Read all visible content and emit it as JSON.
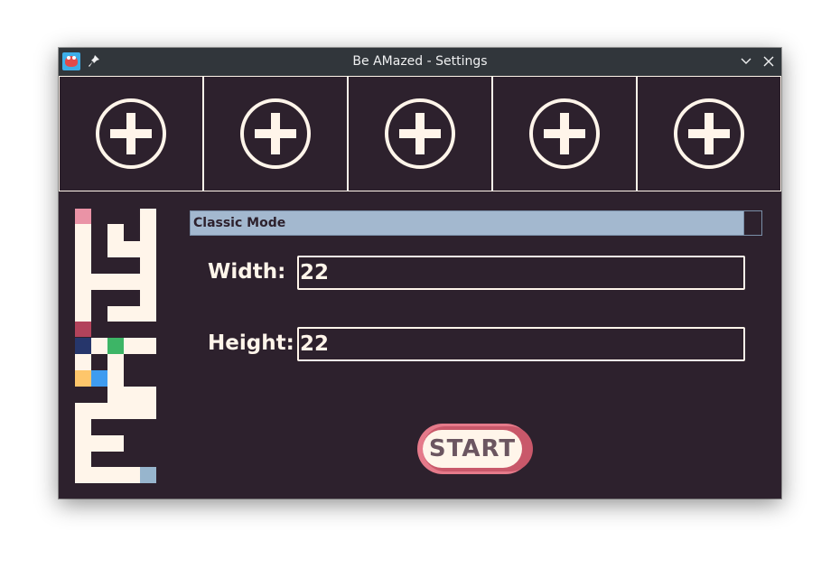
{
  "window": {
    "title": "Be AMazed - Settings"
  },
  "player_slots": [
    {
      "icon": "add-circle-icon"
    },
    {
      "icon": "add-circle-icon"
    },
    {
      "icon": "add-circle-icon"
    },
    {
      "icon": "add-circle-icon"
    },
    {
      "icon": "add-circle-icon"
    }
  ],
  "settings": {
    "mode": {
      "selected": "Classic Mode"
    },
    "width": {
      "label": "Width:",
      "value": "22"
    },
    "height": {
      "label": "Height:",
      "value": "22"
    }
  },
  "start_button": {
    "label": "START"
  },
  "colors": {
    "background": "#2d212d",
    "foreground": "#fff5ea",
    "titlebar": "#31363b",
    "select": "#a3b8cf",
    "start_accent": "#e57a8a"
  }
}
